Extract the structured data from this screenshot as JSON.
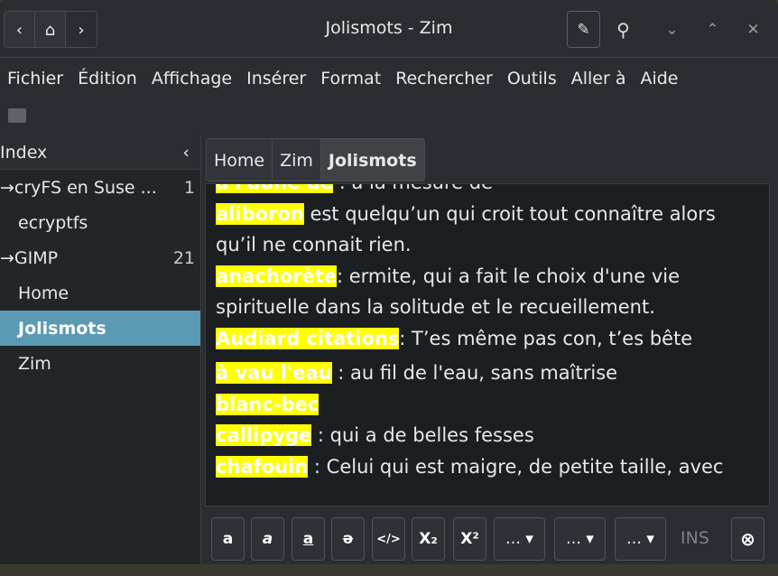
{
  "window": {
    "title": "Jolismots - Zim"
  },
  "menu": [
    "Fichier",
    "Édition",
    "Affichage",
    "Insérer",
    "Format",
    "Rechercher",
    "Outils",
    "Aller à",
    "Aide"
  ],
  "sidebar": {
    "title": "Index",
    "items": [
      {
        "label": "→cryFS en Suse ...",
        "count": "1"
      },
      {
        "label": "ecryptfs",
        "count": ""
      },
      {
        "label": "→GIMP",
        "count": "21"
      },
      {
        "label": "Home",
        "count": ""
      },
      {
        "label": "Jolismots",
        "count": "",
        "selected": true
      },
      {
        "label": "Zim",
        "count": ""
      }
    ]
  },
  "breadcrumbs": [
    "Home",
    "Zim",
    "Jolismots"
  ],
  "content": [
    {
      "term": "à l'aune de",
      "def": " : à la mesure de"
    },
    {
      "term": "aliboron",
      "def": " est quelqu’un qui croit tout connaître alors"
    },
    {
      "term": "",
      "def": "qu’il ne connait rien."
    },
    {
      "term": "anachorète",
      "def": ": ermite, qui a fait le choix d'une vie"
    },
    {
      "term": "",
      "def": "spirituelle dans la solitude et le recueillement."
    },
    {
      "term": "Audiard citations",
      "def": ": T’es même pas con, t’es bête"
    },
    {
      "term": "",
      "def": " "
    },
    {
      "term": "à vau l'eau",
      "def": " : au fil de l'eau, sans maîtrise"
    },
    {
      "term": "blanc-bec",
      "def": ""
    },
    {
      "term": "callipyge",
      "def": " : qui a de belles fesses"
    },
    {
      "term": "chafouin",
      "def": " : Celui qui est maigre, de petite taille, avec"
    }
  ],
  "format": {
    "bold": "a",
    "italic": "a",
    "underline": "a",
    "strike": "ə",
    "code": "</>",
    "sub": "X₂",
    "sup": "X²",
    "dd": "… ▾",
    "mode": "INS"
  }
}
